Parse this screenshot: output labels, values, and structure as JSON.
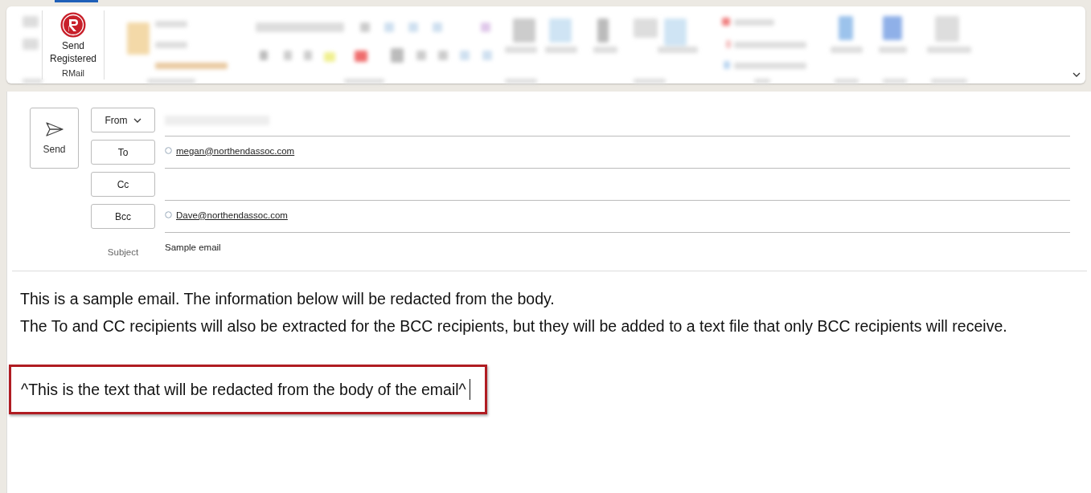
{
  "ribbon": {
    "rmail_button": "Send\nRegistered",
    "rmail_group": "RMail"
  },
  "compose": {
    "send": "Send",
    "fields": [
      {
        "kind": "from",
        "label": "From"
      },
      {
        "kind": "address",
        "label": "To",
        "recipients": [
          "megan@northendassoc.com"
        ]
      },
      {
        "kind": "address",
        "label": "Cc"
      },
      {
        "kind": "address",
        "label": "Bcc",
        "recipients": [
          "Dave@northendassoc.com"
        ]
      }
    ],
    "subject_label": "Subject",
    "subject": "Sample email"
  },
  "body": {
    "paragraphs": [
      "This is a sample email. The information below will be redacted from the body.",
      "The To and CC recipients will also be extracted for the BCC recipients, but they will be added to a text file that only BCC recipients will receive."
    ],
    "redacted": "^This is the text that will be redacted from the body of the email^"
  }
}
